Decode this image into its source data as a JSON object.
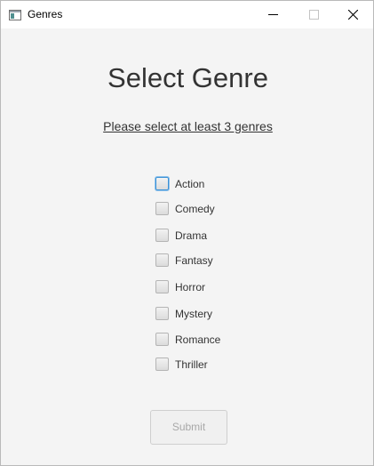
{
  "window": {
    "title": "Genres",
    "icon": "window-app-icon",
    "controls": [
      "minimize-icon",
      "maximize-icon",
      "close-icon"
    ]
  },
  "main": {
    "heading": "Select Genre",
    "instruction": "Please select at least 3 genres",
    "genres": [
      {
        "label": "Action",
        "checked": false,
        "focused": true
      },
      {
        "label": "Comedy",
        "checked": false,
        "focused": false
      },
      {
        "label": "Drama",
        "checked": false,
        "focused": false
      },
      {
        "label": "Fantasy",
        "checked": false,
        "focused": false
      },
      {
        "label": "Horror",
        "checked": false,
        "focused": false
      },
      {
        "label": "Mystery",
        "checked": false,
        "focused": false
      },
      {
        "label": "Romance",
        "checked": false,
        "focused": false
      },
      {
        "label": "Thriller",
        "checked": false,
        "focused": false
      }
    ],
    "submit_label": "Submit",
    "submit_enabled": false
  },
  "colors": {
    "background": "#f4f4f4",
    "text": "#333333",
    "focus_ring": "#3b91d6",
    "disabled_text": "#a8a8a8"
  }
}
